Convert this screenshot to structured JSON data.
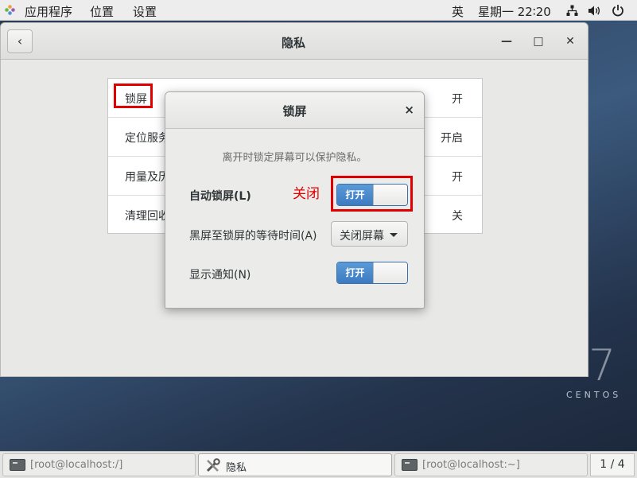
{
  "topbar": {
    "apps": "应用程序",
    "places": "位置",
    "settings": "设置",
    "input_method": "英",
    "datetime": "星期一 22∶20",
    "icons": [
      "network-icon",
      "volume-icon",
      "power-icon"
    ]
  },
  "desktop": {
    "logo_seven": "7",
    "logo_text": "CENTOS"
  },
  "window": {
    "title": "隐私",
    "back": "‹",
    "minimize": "—",
    "maximize": "□",
    "close": "✕",
    "rows": [
      {
        "label": "锁屏",
        "value": "开"
      },
      {
        "label": "定位服务",
        "value": "开启"
      },
      {
        "label": "用量及历史",
        "value": "开"
      },
      {
        "label": "清理回收站",
        "value": "关"
      }
    ]
  },
  "dialog": {
    "title": "锁屏",
    "close": "×",
    "description": "离开时锁定屏幕可以保护隐私。",
    "auto_lock_label": "自动锁屏(L)",
    "auto_lock_state": "打开",
    "blank_delay_label": "黑屏至锁屏的等待时间(A)",
    "blank_delay_value": "关闭屏幕",
    "notifications_label": "显示通知(N)",
    "notifications_state": "打开"
  },
  "annotation": {
    "text": "关闭",
    "color": "#e00000"
  },
  "taskbar": {
    "tasks": [
      {
        "label": "[root@localhost:/]"
      },
      {
        "label": "隐私"
      },
      {
        "label": "[root@localhost:~]"
      }
    ],
    "pager": "1 / 4"
  },
  "colors": {
    "accent": "#3d7bc1",
    "annotation_red": "#e00000"
  }
}
